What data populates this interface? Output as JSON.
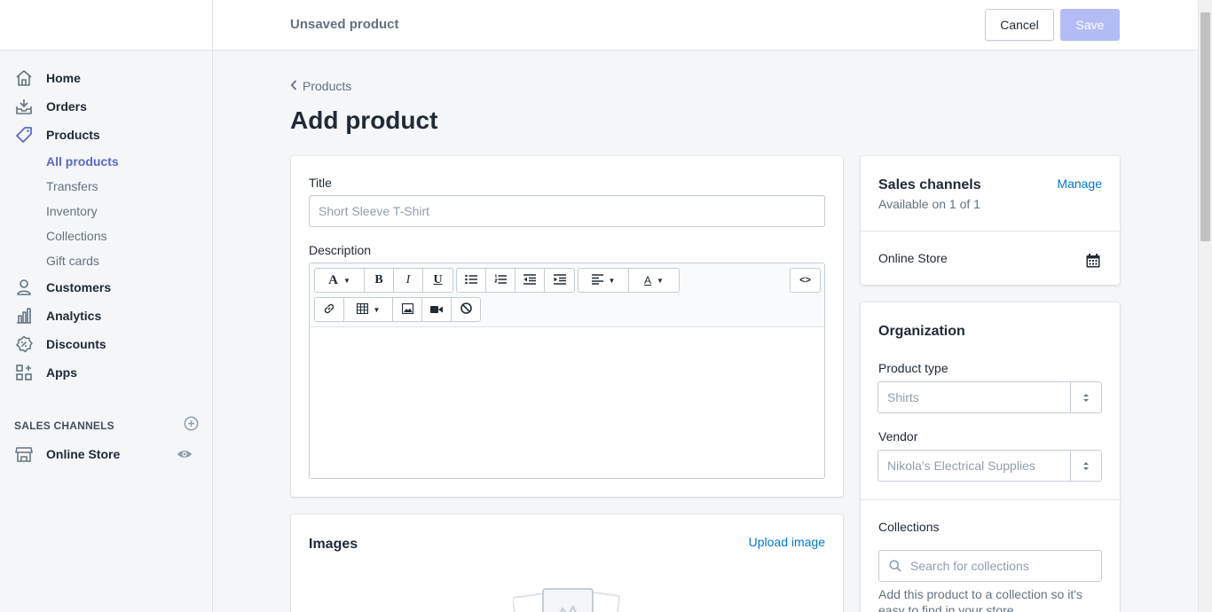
{
  "header": {
    "status": "Unsaved product",
    "cancel_label": "Cancel",
    "save_label": "Save"
  },
  "sidebar": {
    "items": [
      {
        "label": "Home",
        "icon": "home-icon"
      },
      {
        "label": "Orders",
        "icon": "orders-icon"
      },
      {
        "label": "Products",
        "icon": "tag-icon"
      },
      {
        "label": "Customers",
        "icon": "person-icon"
      },
      {
        "label": "Analytics",
        "icon": "bar-chart-icon"
      },
      {
        "label": "Discounts",
        "icon": "discount-icon"
      },
      {
        "label": "Apps",
        "icon": "apps-icon"
      }
    ],
    "product_sub": [
      "All products",
      "Transfers",
      "Inventory",
      "Collections",
      "Gift cards"
    ],
    "active_sub": "All products",
    "channels_heading": "SALES CHANNELS",
    "online_store": "Online Store"
  },
  "main": {
    "breadcrumb": "Products",
    "title": "Add product",
    "title_label": "Title",
    "title_placeholder": "Short Sleeve T-Shirt",
    "description_label": "Description",
    "html_button": "<>",
    "images_title": "Images",
    "upload_label": "Upload image"
  },
  "sales_channels": {
    "title": "Sales channels",
    "manage": "Manage",
    "availability": "Available on 1 of 1",
    "channel": "Online Store"
  },
  "organization": {
    "title": "Organization",
    "product_type_label": "Product type",
    "product_type_value": "Shirts",
    "vendor_label": "Vendor",
    "vendor_value": "Nikola's Electrical Supplies",
    "collections_label": "Collections",
    "collections_placeholder": "Search for collections",
    "collections_help": "Add this product to a collection so it's easy to find in your store."
  },
  "colors": {
    "accent": "#5c6ac4",
    "link": "#007ace",
    "save_disabled": "#b3bcf5"
  }
}
